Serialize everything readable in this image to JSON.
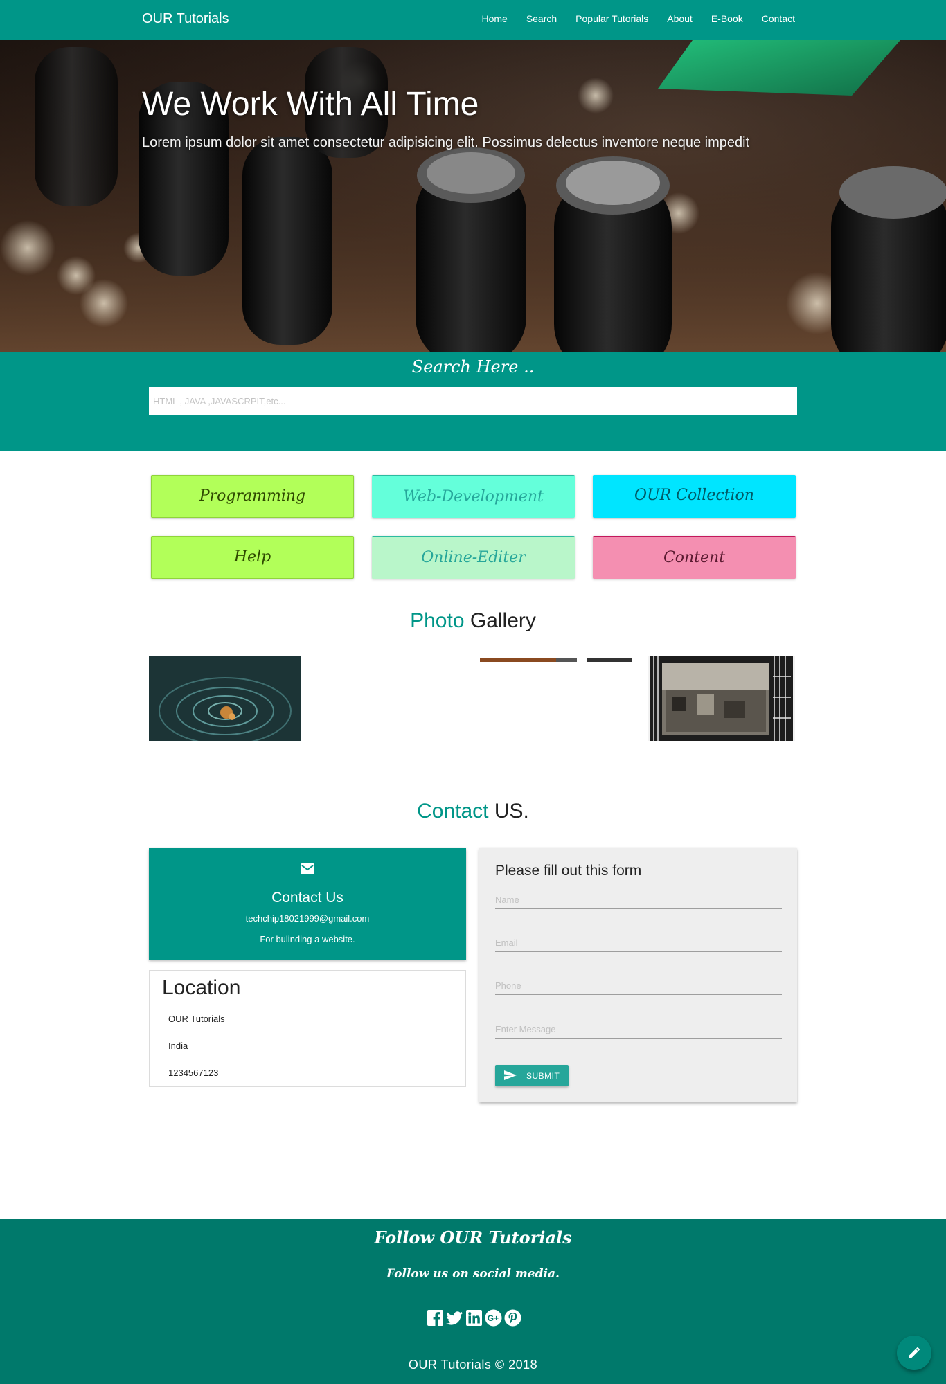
{
  "navbar": {
    "brand": "OUR Tutorials",
    "links": [
      "Home",
      "Search",
      "Popular Tutorials",
      "About",
      "E-Book",
      "Contact"
    ]
  },
  "hero": {
    "title": "We Work With All Time",
    "subtitle": "Lorem ipsum dolor sit amet consectetur adipisicing elit. Possimus delectus inventore neque impedit"
  },
  "search": {
    "title": "Search Here ..",
    "placeholder": "HTML , JAVA ,JAVASCRPIT,etc..."
  },
  "categories": [
    "Programming",
    "Web-Development",
    "OUR Collection",
    "Help",
    "Online-Editer",
    "Content"
  ],
  "gallery": {
    "title_accent": "Photo",
    "title_rest": "Gallery"
  },
  "contact": {
    "title_accent": "Contact",
    "title_rest": "US.",
    "card": {
      "title": "Contact Us",
      "email": "techchip18021999@gmail.com",
      "description": "For bulinding a website."
    },
    "location": {
      "title": "Location",
      "rows": [
        "OUR Tutorials",
        "India",
        "1234567123"
      ]
    },
    "form": {
      "title": "Please fill out this form",
      "name_placeholder": "Name",
      "email_placeholder": "Email",
      "phone_placeholder": "Phone",
      "message_placeholder": "Enter Message",
      "submit_label": "SUBMIT"
    }
  },
  "footer": {
    "title": "Follow OUR Tutorials",
    "subtitle": "Follow us on social media.",
    "social_icons": [
      "facebook-icon",
      "twitter-icon",
      "linkedin-icon",
      "google-plus-icon",
      "pinterest-icon"
    ],
    "copyright": "OUR Tutorials © 2018"
  },
  "colors": {
    "primary": "#009688",
    "footer": "#00796b",
    "tile_green": "#b2ff59",
    "tile_aqua": "#64ffda",
    "tile_cyan": "#00e5ff",
    "tile_mint": "#b9f6ca",
    "tile_pink": "#f48fb1"
  }
}
